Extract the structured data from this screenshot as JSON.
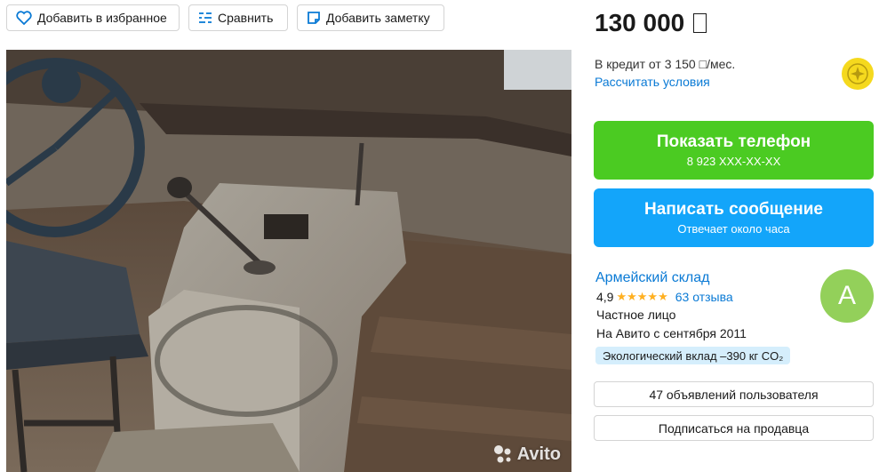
{
  "actions": {
    "favorite_label": "Добавить в избранное",
    "compare_label": "Сравнить",
    "note_label": "Добавить заметку"
  },
  "listing": {
    "price": "130 000",
    "credit_text": "В кредит от 3 150 □/мес.",
    "credit_link": "Рассчитать условия",
    "watermark": "Avito"
  },
  "contact": {
    "phone_label": "Показать телефон",
    "phone_masked": "8 923 XXX-XX-XX",
    "message_label": "Написать сообщение",
    "message_sub": "Отвечает около часа"
  },
  "seller": {
    "name": "Армейский склад",
    "rating": "4,9",
    "stars": "★★★★★",
    "reviews": "63 отзыва",
    "type": "Частное лицо",
    "since": "На Авито с сентября 2011",
    "eco_badge": "Экологический вклад –390 кг CO₂",
    "avatar_letter": "А",
    "ads_button": "47 объявлений пользователя",
    "subscribe_button": "Подписаться на продавца"
  },
  "colors": {
    "phone_button": "#4bcb22",
    "message_button": "#13a5fa",
    "link": "#0a7ad5",
    "avatar": "#93d05a",
    "star": "#ffb021"
  },
  "icons": {
    "favorite": "heart-icon",
    "compare": "compare-icon",
    "note": "note-icon",
    "coin": "coin-icon"
  }
}
